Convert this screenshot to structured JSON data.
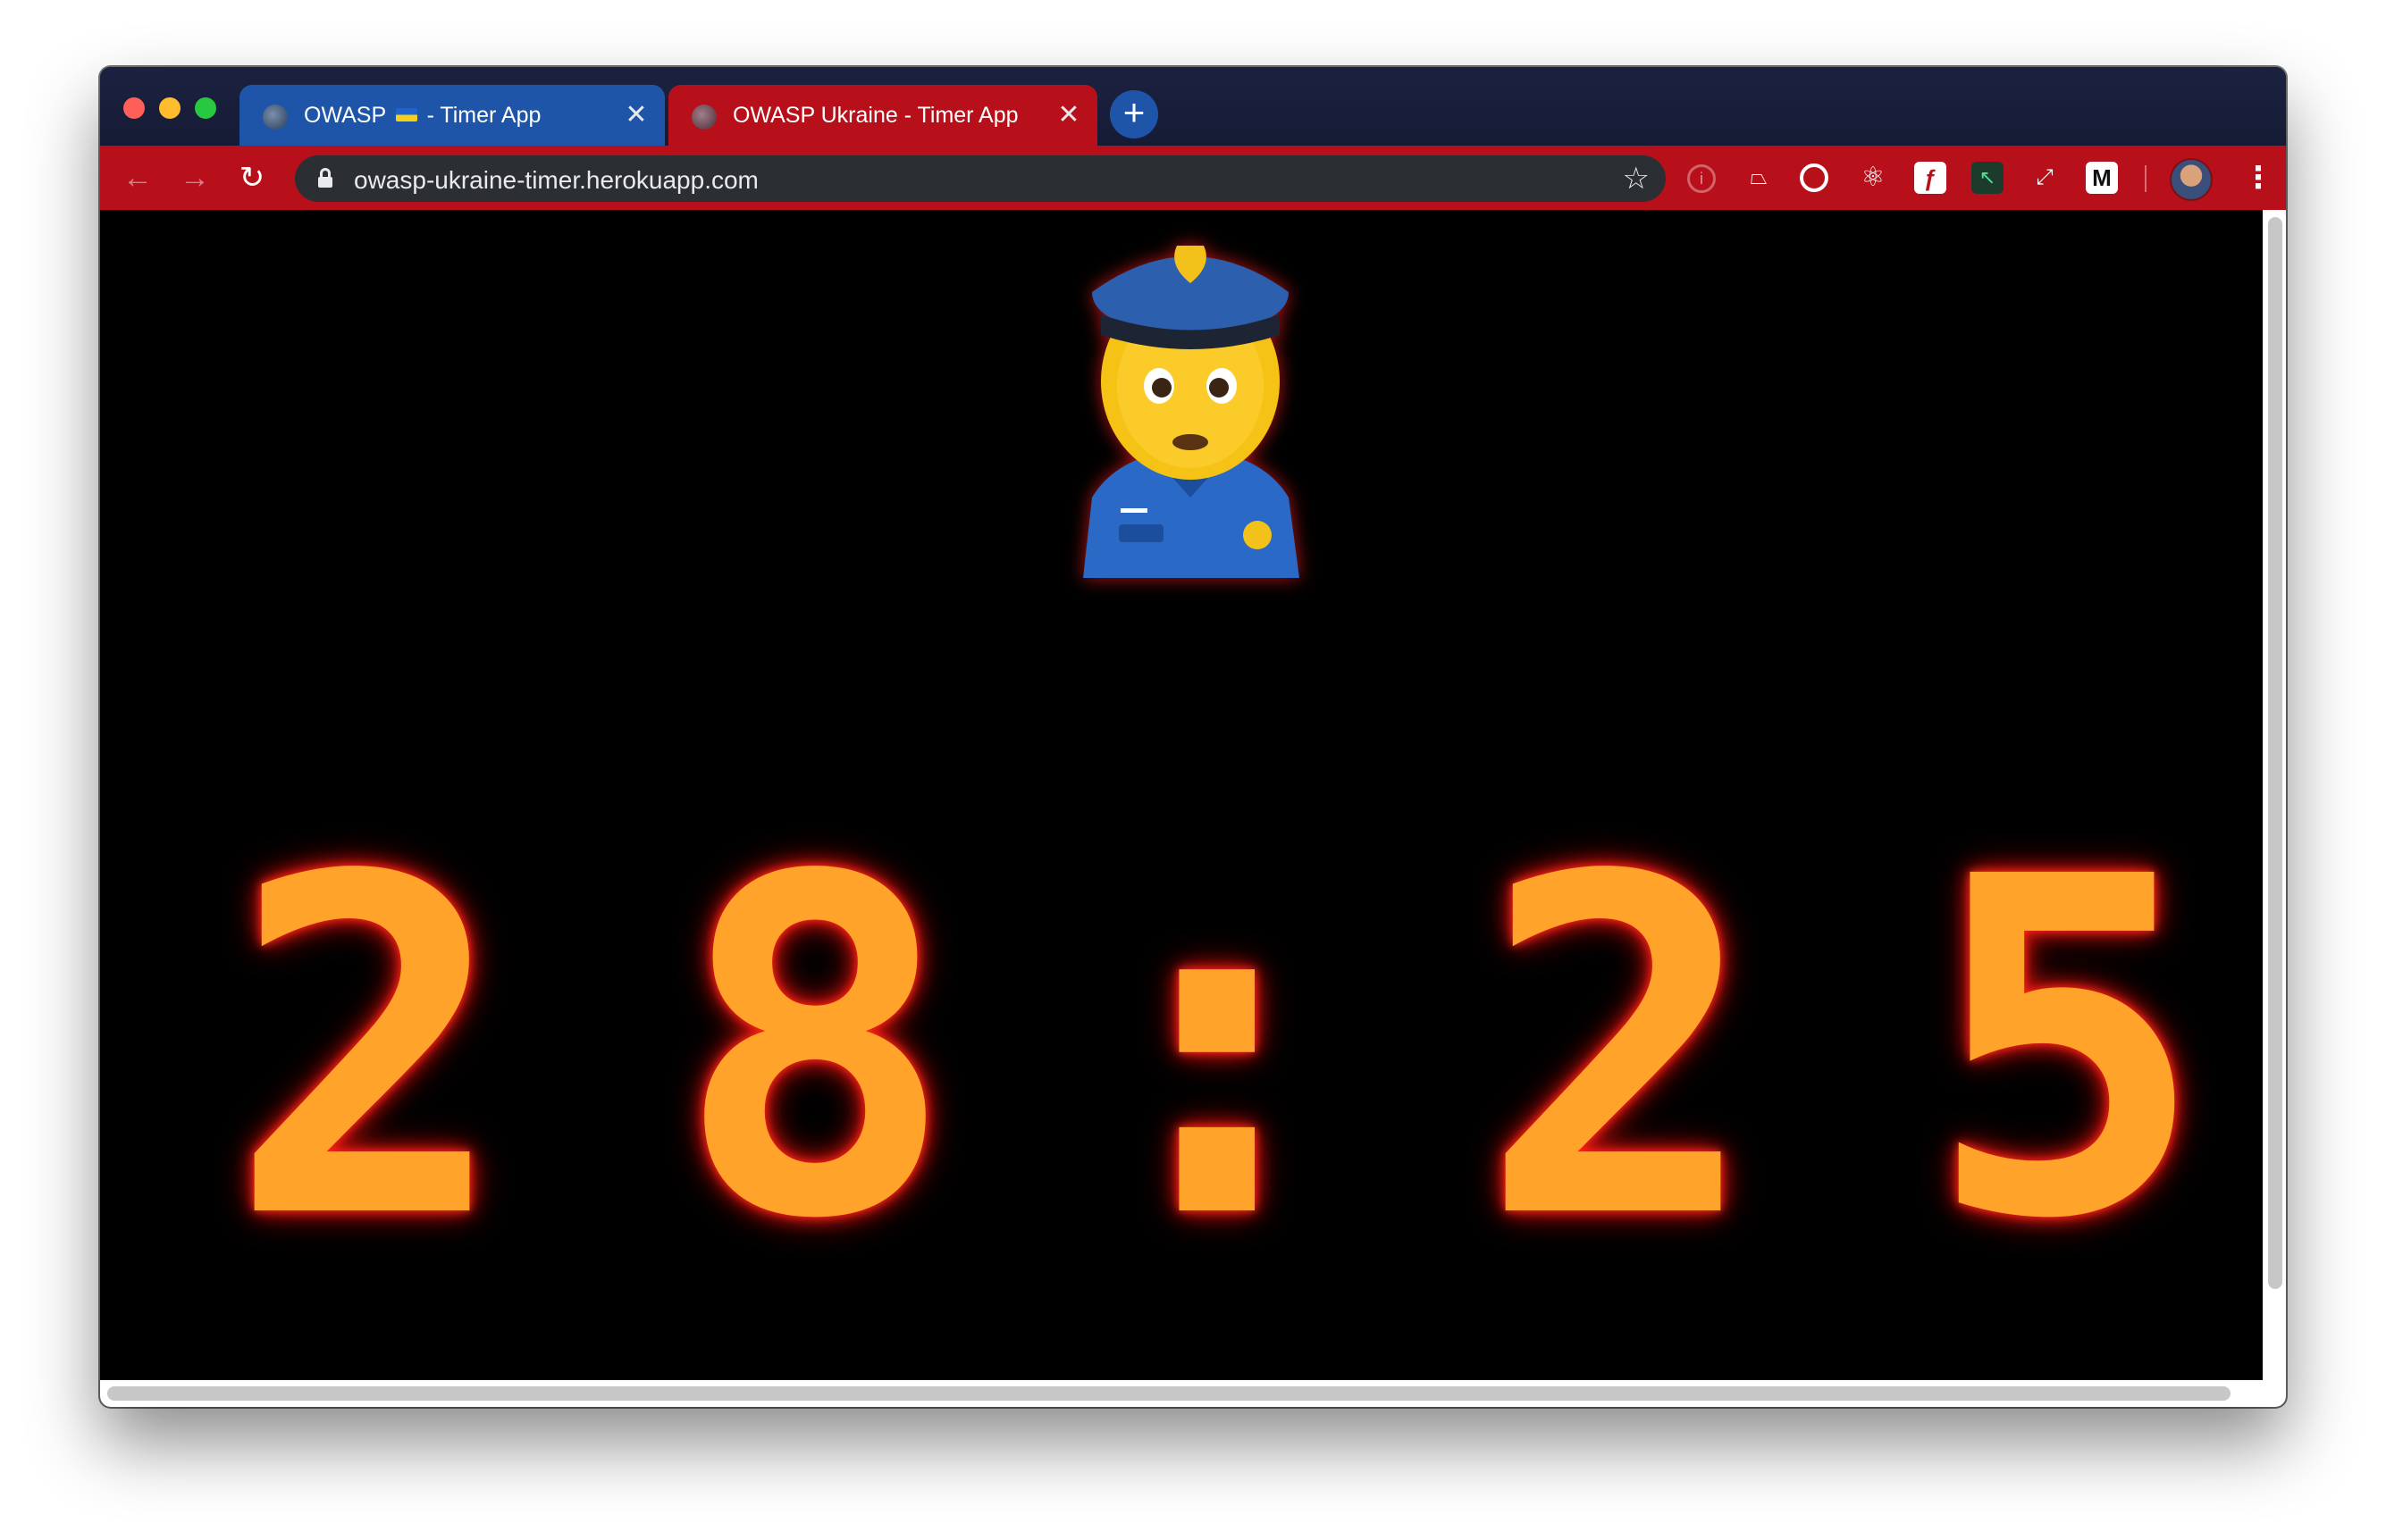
{
  "browser": {
    "tabs": [
      {
        "title_prefix": "OWASP",
        "flag": "ukraine-flag",
        "title_suffix": "- Timer App",
        "close": "✕"
      },
      {
        "title": "OWASP Ukraine - Timer App",
        "close": "✕"
      }
    ],
    "new_tab": "+",
    "url": "owasp-ukraine-timer.herokuapp.com",
    "extensions": [
      "1password-icon",
      "tampermonkey-icon",
      "target-icon",
      "react-devtools-icon",
      "feedly-icon",
      "cursor-icon",
      "telescope-icon",
      "medium-icon"
    ],
    "colors": {
      "tab_active": "#b7101a",
      "tab_inactive": "#1f55a8",
      "toolbar": "#b7101a"
    }
  },
  "page": {
    "emoji": "police-officer-woman",
    "timer": {
      "minutes_tens": "2",
      "minutes_ones": "8",
      "separator": ":",
      "seconds_tens": "2",
      "seconds_ones": "5"
    },
    "timer_color": "#ffa32a",
    "glow_color": "#e0140f"
  }
}
